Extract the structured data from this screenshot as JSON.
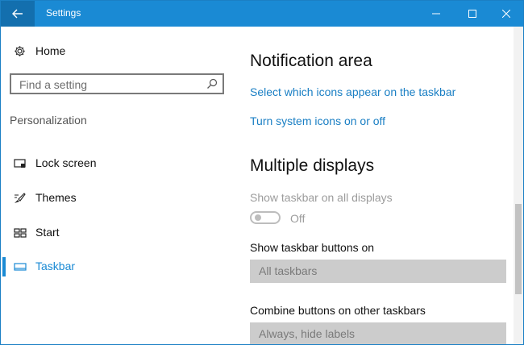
{
  "window": {
    "title": "Settings",
    "accent_color": "#1a8ad4"
  },
  "sidebar": {
    "home_label": "Home",
    "search_placeholder": "Find a setting",
    "section_label": "Personalization",
    "items": [
      {
        "label": "Lock screen",
        "icon": "lock-screen-icon",
        "active": false
      },
      {
        "label": "Themes",
        "icon": "themes-brush-icon",
        "active": false
      },
      {
        "label": "Start",
        "icon": "start-tiles-icon",
        "active": false
      },
      {
        "label": "Taskbar",
        "icon": "taskbar-icon",
        "active": true
      }
    ]
  },
  "main": {
    "notification_area": {
      "heading": "Notification area",
      "link_icons": "Select which icons appear on the taskbar",
      "link_system_icons": "Turn system icons on or off"
    },
    "multiple_displays": {
      "heading": "Multiple displays",
      "show_taskbar_label": "Show taskbar on all displays",
      "toggle_state": "Off",
      "show_buttons_label": "Show taskbar buttons on",
      "show_buttons_value": "All taskbars",
      "combine_label": "Combine buttons on other taskbars",
      "combine_value": "Always, hide labels"
    }
  }
}
